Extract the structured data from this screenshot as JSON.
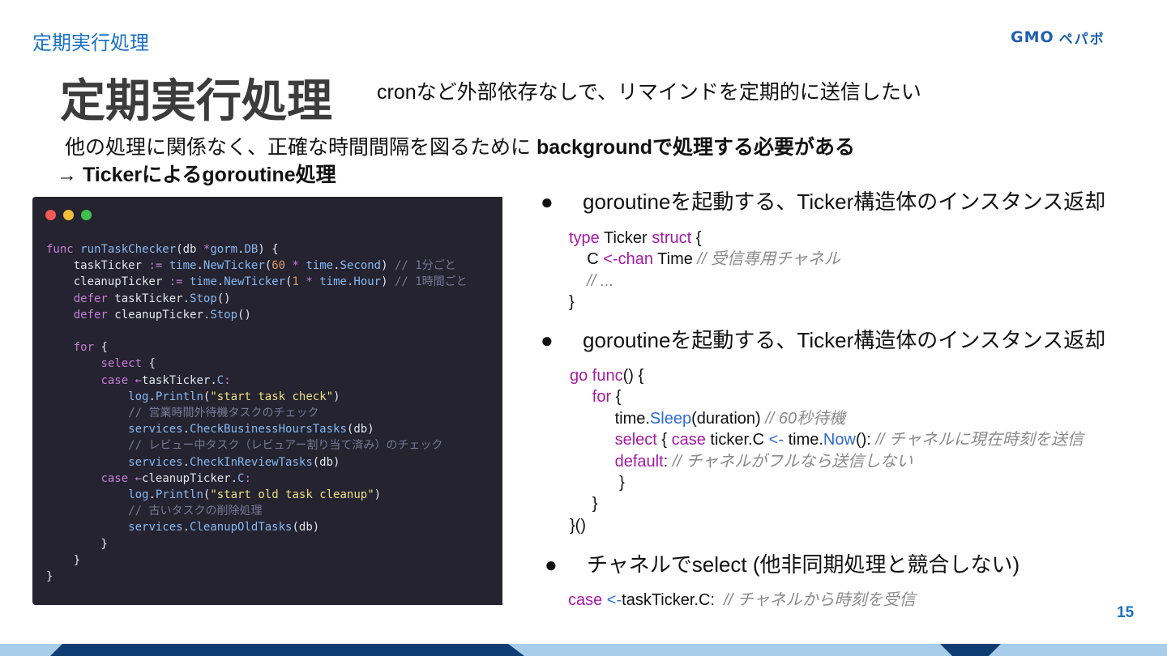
{
  "header": {
    "section_label": "定期実行処理",
    "logo_gmo": "GMO",
    "logo_kana": "ペパボ"
  },
  "title": "定期実行処理",
  "subtitle": "cronなど外部依存なしで、リマインドを定期的に送信したい",
  "description": {
    "line1_prefix": "他の処理に関係なく、正確な時間間隔を図るために ",
    "line1_bold": "backgroundで処理する必要がある",
    "line2": "→ Tickerによるgoroutine処理"
  },
  "code_panel": {
    "window_dots": [
      "#ee5c53",
      "#f2bd3a",
      "#3ec24f"
    ],
    "lines": [
      "func runTaskChecker(db *gorm.DB) {",
      "    taskTicker := time.NewTicker(60 * time.Second) // 1分ごと",
      "    cleanupTicker := time.NewTicker(1 * time.Hour) // 1時間ごと",
      "    defer taskTicker.Stop()",
      "    defer cleanupTicker.Stop()",
      "",
      "    for {",
      "        select {",
      "        case ←taskTicker.C:",
      "            log.Println(\"start task check\")",
      "            // 営業時間外待機タスクのチェック",
      "            services.CheckBusinessHoursTasks(db)",
      "            // レビュー中タスク（レビュアー割り当て済み）のチェック",
      "            services.CheckInReviewTasks(db)",
      "        case ←cleanupTicker.C:",
      "            log.Println(\"start old task cleanup\")",
      "            // 古いタスクの削除処理",
      "            services.CleanupOldTasks(db)",
      "        }",
      "    }",
      "}"
    ]
  },
  "bullets": [
    "goroutineを起動する、Ticker構造体のインスタンス返却",
    "goroutineを起動する、Ticker構造体のインスタンス返却",
    "チャネルでselect (他非同期処理と競合しない)"
  ],
  "bullet_marker": "●",
  "snippet1": {
    "l1_type": "type",
    "l1_name": " Ticker ",
    "l1_struct": "struct",
    "l1_brace": " {",
    "l2_c": "C ",
    "l2_chan": "<-chan",
    "l2_time": " Time ",
    "l2_comment": "// 受信専用チャネル",
    "l3_comment": "// ...",
    "l4": "}"
  },
  "snippet2": {
    "l1_go": "go",
    "l1_func": " func",
    "l1_rest": "() {",
    "l2_for": "for",
    "l2_rest": " {",
    "l3_time": "time.",
    "l3_sleep": "Sleep",
    "l3_args": "(duration) ",
    "l3_comment": "// 60秒待機",
    "l4_select": "select",
    "l4_brace": " { ",
    "l4_case": "case",
    "l4_ticker": " ticker.C ",
    "l4_arrow": "<-",
    "l4_time": " time.",
    "l4_now": "Now",
    "l4_rest": "(): ",
    "l4_comment": "// チャネルに現在時刻を送信",
    "l5_default": "default",
    "l5_colon": ": ",
    "l5_comment": "// チャネルがフルなら送信しない",
    "l6": "}",
    "l7": "}",
    "l8": "}()"
  },
  "snippet3": {
    "case": "case",
    "arrow": " <-",
    "rest": "taskTicker.C:  ",
    "comment": "// チャネルから時刻を受信"
  },
  "page_number": "15"
}
